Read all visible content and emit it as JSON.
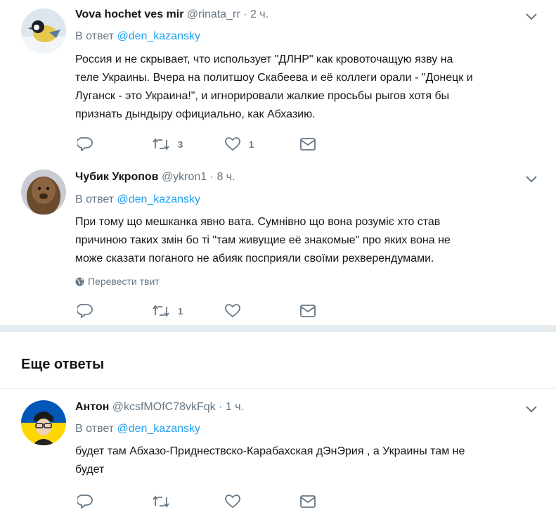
{
  "tweets": [
    {
      "name": "Vova hochet ves mir",
      "handle": "@rinata_rr",
      "time": "2 ч.",
      "reply_prefix": "В ответ",
      "reply_to": "@den_kazansky",
      "lines": [
        "Россия и не скрывает, что использует \"ДЛНР\" как кровоточащую язву на",
        "теле Украины. Вчера на политшоу Скабеева и её коллеги орали - \"Донецк и",
        "Луганск - это Украина!\", и игнорировали жалкие просьбы рыгов хотя бы",
        "признать дындыру официально, как Абхазию."
      ],
      "retweets": "3",
      "likes": "1"
    },
    {
      "name": "Чубик Укропов",
      "handle": "@ykron1",
      "time": "8 ч.",
      "reply_prefix": "В ответ",
      "reply_to": "@den_kazansky",
      "lines": [
        "При тому що мешканка явно вата. Сумнівно що вона розуміє хто став",
        "причиною таких змін бо ті \"там живущие её знакомые\" про яких вона не",
        "може сказати поганого не абияк посприяли своїми рехверендумами."
      ],
      "translate": "Перевести твит",
      "retweets": "1",
      "likes": ""
    },
    {
      "name": "Антон",
      "handle": "@kcsfMOfC78vkFqk",
      "time": "1 ч.",
      "reply_prefix": "В ответ",
      "reply_to": "@den_kazansky",
      "lines": [
        "будет там Абхазо-Приднествско-Карабахская дЭнЭрия , а Украины там не",
        "будет"
      ],
      "retweets": "",
      "likes": ""
    }
  ],
  "section": {
    "more_replies": "Еще ответы"
  },
  "colors": {
    "accent": "#1da1f2",
    "muted": "#657786",
    "divider": "#e6ecf0"
  },
  "icons": [
    "reply-icon",
    "retweet-icon",
    "like-icon",
    "message-icon",
    "caret-down-icon",
    "globe-icon"
  ]
}
